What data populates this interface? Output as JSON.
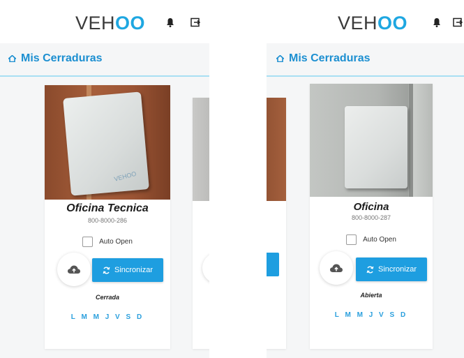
{
  "brand": {
    "logo_prefix": "VEH",
    "logo_accent": "OO",
    "accent": "#1ea7e1",
    "title_color": "#1c8fd1",
    "button_color": "#1e9ee0"
  },
  "nav": {
    "title": "Mis Cerraduras",
    "icon": "home-icon"
  },
  "screens": [
    {
      "locks": [
        {
          "name": "Oficina Tecnica",
          "serial": "800-8000-286",
          "auto_open_label": "Auto Open",
          "auto_open_checked": false,
          "sync_label": "Sincronizar",
          "status": "Cerrada",
          "days": "L M M J V S D",
          "device_label": "VEHOO"
        }
      ]
    },
    {
      "locks": [
        {
          "name": "Oficina",
          "serial": "800-8000-287",
          "auto_open_label": "Auto Open",
          "auto_open_checked": false,
          "sync_label": "Sincronizar",
          "status": "Abierta",
          "days": "L M M J V S D"
        }
      ]
    }
  ],
  "icons": {
    "notifications": "bell-icon",
    "logout": "logout-icon",
    "cloud": "cloud-upload-icon",
    "sync": "sync-icon"
  }
}
